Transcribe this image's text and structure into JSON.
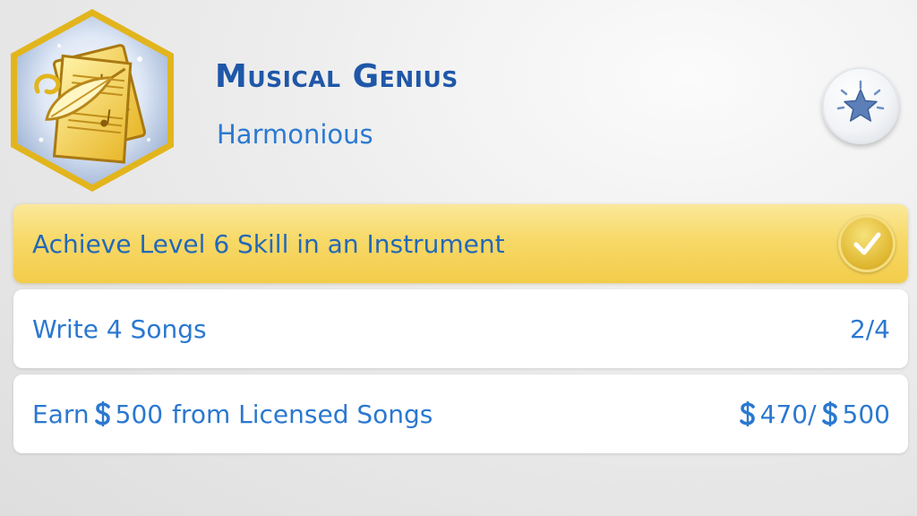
{
  "aspiration": {
    "title": "Musical Genius",
    "subtitle": "Harmonious",
    "icon": "sheet-music-quill-icon",
    "favorite_icon": "star-icon"
  },
  "goals": [
    {
      "label": "Achieve Level 6 Skill in an Instrument",
      "status": "completed",
      "icon": "checkmark-icon"
    },
    {
      "label": "Write 4 Songs",
      "progress": "2/4",
      "current": 2,
      "target": 4
    },
    {
      "label_prefix": "Earn",
      "label_amount": "500",
      "label_suffix": "from Licensed Songs",
      "progress_current": "470",
      "progress_separator": "/",
      "progress_target": "500",
      "currency_icon": "simoleon-icon",
      "current": 470,
      "target": 500
    }
  ],
  "colors": {
    "title": "#1f57a8",
    "text": "#2b78d0",
    "completed_bg": "#f7d968",
    "icon_border": "#e6b800"
  }
}
